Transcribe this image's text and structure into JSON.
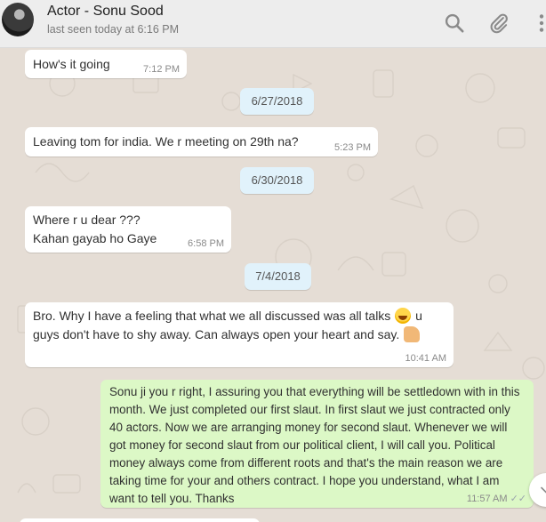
{
  "header": {
    "contact_name": "Actor - Sonu Sood",
    "last_seen": "last seen today at 6:16 PM",
    "icons": [
      "avatar",
      "search-icon",
      "paperclip-icon",
      "more-vertical-icon"
    ]
  },
  "messages": [
    {
      "type": "in",
      "text": "How's it going",
      "time": "7:12 PM"
    },
    {
      "type": "date",
      "text": "6/27/2018"
    },
    {
      "type": "in",
      "text": "Leaving tom for india. We r meeting on 29th na?",
      "time": "5:23 PM"
    },
    {
      "type": "date",
      "text": "6/30/2018"
    },
    {
      "type": "in",
      "text": "Where r u dear ???\nKahan gayab ho Gaye",
      "time": "6:58 PM"
    },
    {
      "type": "date",
      "text": "7/4/2018"
    },
    {
      "type": "in",
      "text_1": "Bro. Why I have a feeling that what we all discussed was all talks",
      "text_2": "u",
      "text_3": "guys don't have to shy away. Can always open your heart and say.",
      "emojis": [
        "laughing-emoji",
        "thumbs-up-emoji"
      ],
      "time": "10:41 AM"
    },
    {
      "type": "out",
      "text": "Sonu ji you r right, I assuring you that everything will be settledown with in this month. We just completed our first slaut. In first slaut we just contracted only 40 actors. Now we are arranging money for second slaut. Whenever we will got money for second slaut from our political client, I will call you. Political money always come from different roots and that's the main reason we are taking time for your and others contract. I hope you understand, what I am want to tell you. Thanks",
      "time": "11:57 AM",
      "status": "read"
    }
  ],
  "colors": {
    "header_bg": "#ededed",
    "chat_bg": "#e5ddd5",
    "incoming_bubble": "#ffffff",
    "outgoing_bubble": "#dcf8c6",
    "date_chip": "#e1f2fb"
  }
}
